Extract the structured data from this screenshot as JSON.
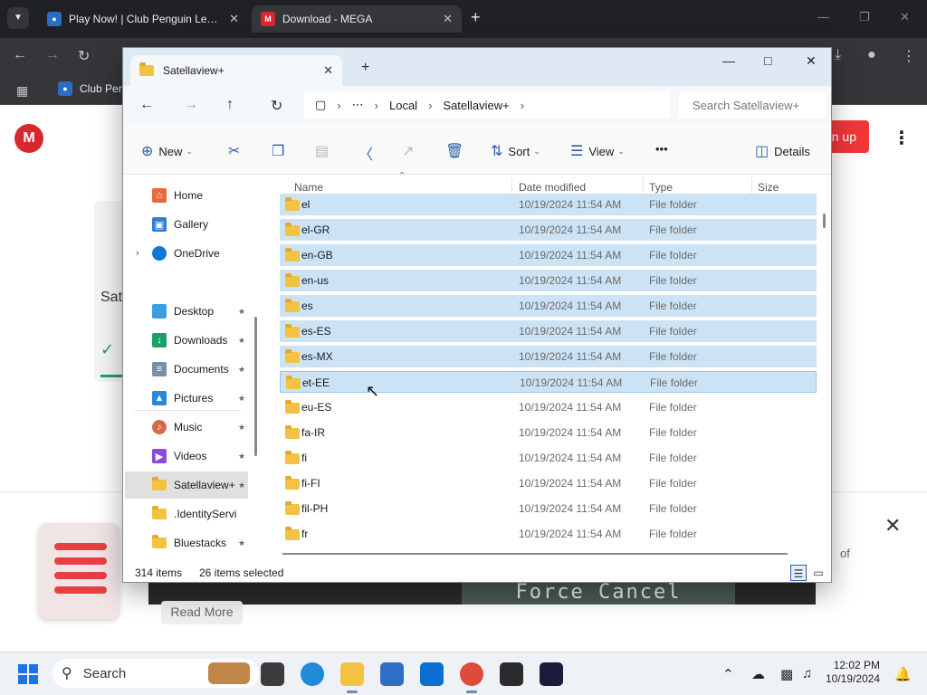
{
  "browser": {
    "tabs": [
      {
        "title": "Play Now! | Club Penguin Legac",
        "favicon": "club-penguin-icon"
      },
      {
        "title": "Download - MEGA",
        "favicon": "mega-icon"
      }
    ],
    "bookmarks": [
      {
        "label": "Club Pen"
      }
    ],
    "page": {
      "logo_text": "M",
      "signup_label": "n up",
      "card_text": "Sat",
      "read_more_label": "Read More",
      "video_text": "Force Cancel",
      "promo_text": "of"
    }
  },
  "explorer": {
    "tab_title": "Satellaview+",
    "breadcrumb": [
      "Local",
      "Satellaview+"
    ],
    "search_placeholder": "Search Satellaview+",
    "commands": {
      "new": "New",
      "sort": "Sort",
      "view": "View",
      "more": "•••",
      "details": "Details"
    },
    "nav_pane": [
      {
        "label": "Home",
        "icon": "home-icon",
        "color": "#e46b3d"
      },
      {
        "label": "Gallery",
        "icon": "gallery-icon",
        "color": "#2f7fd1"
      },
      {
        "label": "OneDrive",
        "icon": "onedrive-icon",
        "color": "#0f78d4"
      },
      {
        "label": "Desktop",
        "icon": "desktop-icon",
        "color": "#3aa0e0"
      },
      {
        "label": "Downloads",
        "icon": "downloads-icon",
        "color": "#1aa16b"
      },
      {
        "label": "Documents",
        "icon": "documents-icon",
        "color": "#7a8ea6"
      },
      {
        "label": "Pictures",
        "icon": "pictures-icon",
        "color": "#2a88d8"
      },
      {
        "label": "Music",
        "icon": "music-icon",
        "color": "#d46a4b"
      },
      {
        "label": "Videos",
        "icon": "videos-icon",
        "color": "#8a4bd8"
      },
      {
        "label": "Satellaview+",
        "icon": "folder-icon",
        "color": "#f3c242"
      },
      {
        "label": ".IdentityServi",
        "icon": "folder-icon",
        "color": "#f3c242"
      },
      {
        "label": "Bluestacks",
        "icon": "folder-icon",
        "color": "#f3c242"
      }
    ],
    "columns": {
      "name": "Name",
      "date": "Date modified",
      "type": "Type",
      "size": "Size"
    },
    "files": [
      {
        "name": "el",
        "date": "10/19/2024 11:54 AM",
        "type": "File folder",
        "selected": true
      },
      {
        "name": "el-GR",
        "date": "10/19/2024 11:54 AM",
        "type": "File folder",
        "selected": true
      },
      {
        "name": "en-GB",
        "date": "10/19/2024 11:54 AM",
        "type": "File folder",
        "selected": true
      },
      {
        "name": "en-us",
        "date": "10/19/2024 11:54 AM",
        "type": "File folder",
        "selected": true
      },
      {
        "name": "es",
        "date": "10/19/2024 11:54 AM",
        "type": "File folder",
        "selected": true
      },
      {
        "name": "es-ES",
        "date": "10/19/2024 11:54 AM",
        "type": "File folder",
        "selected": true
      },
      {
        "name": "es-MX",
        "date": "10/19/2024 11:54 AM",
        "type": "File folder",
        "selected": true
      },
      {
        "name": "et-EE",
        "date": "10/19/2024 11:54 AM",
        "type": "File folder",
        "selected": true
      },
      {
        "name": "eu-ES",
        "date": "10/19/2024 11:54 AM",
        "type": "File folder",
        "selected": false
      },
      {
        "name": "fa-IR",
        "date": "10/19/2024 11:54 AM",
        "type": "File folder",
        "selected": false
      },
      {
        "name": "fi",
        "date": "10/19/2024 11:54 AM",
        "type": "File folder",
        "selected": false
      },
      {
        "name": "fi-FI",
        "date": "10/19/2024 11:54 AM",
        "type": "File folder",
        "selected": false
      },
      {
        "name": "fil-PH",
        "date": "10/19/2024 11:54 AM",
        "type": "File folder",
        "selected": false
      },
      {
        "name": "fr",
        "date": "10/19/2024 11:54 AM",
        "type": "File folder",
        "selected": false
      }
    ],
    "status": {
      "item_count": "314 items",
      "selection": "26 items selected"
    }
  },
  "taskbar": {
    "search_label": "Search",
    "time": "12:02 PM",
    "date": "10/19/2024"
  },
  "colors": {
    "selection": "#cce3f5",
    "accent": "#2a5fa8",
    "mega_red": "#d9272e"
  }
}
